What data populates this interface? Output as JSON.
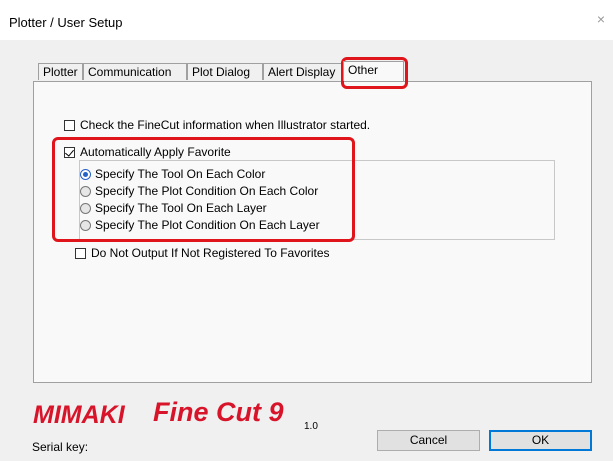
{
  "window": {
    "title": "Plotter / User Setup",
    "close_glyph": "×"
  },
  "tabs": [
    {
      "label": "Plotter"
    },
    {
      "label": "Communication"
    },
    {
      "label": "Plot Dialog"
    },
    {
      "label": "Alert Display"
    },
    {
      "label": "Other"
    }
  ],
  "active_tab": "Other",
  "options": {
    "check_finecut": {
      "label": "Check the FineCut information when Illustrator started.",
      "checked": false
    },
    "auto_apply": {
      "label": "Automatically Apply Favorite",
      "checked": true
    },
    "radios": [
      {
        "label": "Specify The Tool On Each Color",
        "selected": true
      },
      {
        "label": "Specify The Plot Condition On Each Color",
        "selected": false
      },
      {
        "label": "Specify The Tool On Each Layer",
        "selected": false
      },
      {
        "label": "Specify The Plot Condition On Each Layer",
        "selected": false
      }
    ],
    "do_not_output": {
      "label": "Do Not Output If Not Registered To Favorites",
      "checked": false
    }
  },
  "branding": {
    "brand": "Mimaki",
    "product": "FineCut 9",
    "brand_text": "MIMAKI",
    "product_text": "Fine Cut 9",
    "version": "1.0"
  },
  "footer": {
    "serial_label": "Serial key:",
    "cancel": "Cancel",
    "ok": "OK"
  },
  "colors": {
    "highlight": "#e0141b",
    "brand_red": "#d7142a",
    "radio_accent": "#2563c9",
    "ok_border": "#0078d7"
  }
}
